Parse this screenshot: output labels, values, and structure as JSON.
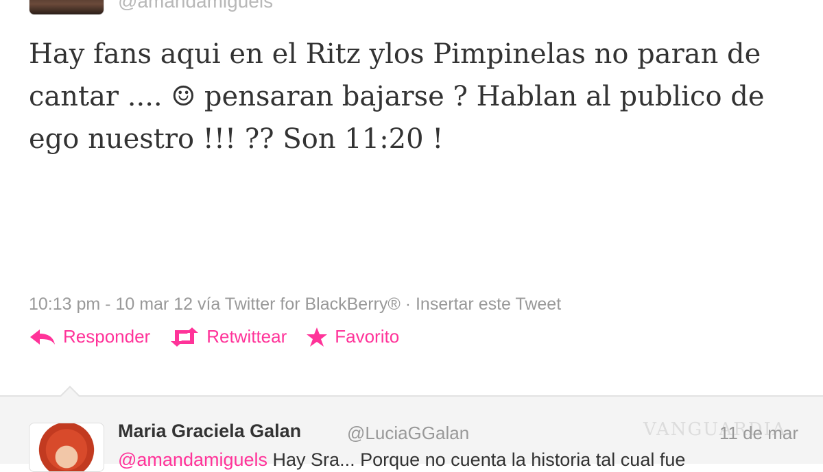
{
  "tweet": {
    "handle": "@amandamiguels",
    "text": "Hay fans aqui en el Ritz ylos Pimpinelas no paran de cantar .... ☺ pensaran bajarse ? Hablan al publico de ego nuestro !!! ?? Son 11:20 !",
    "meta": "10:13 pm - 10 mar 12 vía Twitter for BlackBerry® · Insertar este Tweet",
    "actions": {
      "reply_label": "Responder",
      "retweet_label": "Retwittear",
      "favorite_label": "Favorito"
    }
  },
  "reply": {
    "name": "Maria Graciela Galan",
    "handle": "@LuciaGGalan",
    "date": "11 de mar",
    "mention": "@amandamiguels",
    "text": " Hay Sra... Porque no cuenta la historia tal cual fue"
  },
  "watermark": "VANGUARDIA",
  "colors": {
    "accent": "#ff3399",
    "text": "#333333",
    "muted": "#999999",
    "panel": "#f4f4f4"
  }
}
